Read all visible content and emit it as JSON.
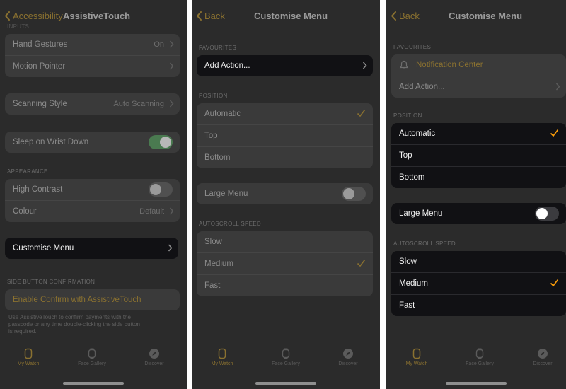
{
  "colors": {
    "accent": "#ff9f0a",
    "dim_accent": "#8a7130",
    "toggle_on": "#4a7a50",
    "highlight_bg": "#111114"
  },
  "panel1": {
    "back_label": "Accessibility",
    "title": "AssistiveTouch",
    "partial_section": "INPUTS",
    "inputs": [
      {
        "label": "Hand Gestures",
        "value": "On"
      },
      {
        "label": "Motion Pointer",
        "value": ""
      }
    ],
    "scanning": {
      "label": "Scanning Style",
      "value": "Auto Scanning"
    },
    "sleep": {
      "label": "Sleep on Wrist Down",
      "on": true
    },
    "appearance_header": "APPEARANCE",
    "high_contrast": {
      "label": "High Contrast",
      "on": false
    },
    "colour": {
      "label": "Colour",
      "value": "Default"
    },
    "customise": {
      "label": "Customise Menu"
    },
    "side_button_header": "SIDE BUTTON CONFIRMATION",
    "enable_confirm": {
      "label": "Enable Confirm with AssistiveTouch"
    },
    "footer_lines": [
      "Use AssistiveTouch to confirm payments with the",
      "passcode or any time double-clicking the side button",
      "is required."
    ]
  },
  "panel2": {
    "back_label": "Back",
    "title": "Customise Menu",
    "favourites_header": "FAVOURITES",
    "add_action": "Add Action...",
    "position_header": "POSITION",
    "position_options": [
      "Automatic",
      "Top",
      "Bottom"
    ],
    "position_selected": "Automatic",
    "large_menu": {
      "label": "Large Menu",
      "on": false
    },
    "autoscroll_header": "AUTOSCROLL SPEED",
    "speed_options": [
      "Slow",
      "Medium",
      "Fast"
    ],
    "speed_selected": "Medium"
  },
  "panel3": {
    "back_label": "Back",
    "title": "Customise Menu",
    "favourites_header": "FAVOURITES",
    "notification_center": "Notification Center",
    "add_action": "Add Action...",
    "position_header": "POSITION",
    "position_options": [
      "Automatic",
      "Top",
      "Bottom"
    ],
    "position_selected": "Automatic",
    "large_menu": {
      "label": "Large Menu",
      "on": false
    },
    "autoscroll_header": "AUTOSCROLL SPEED",
    "speed_options": [
      "Slow",
      "Medium",
      "Fast"
    ],
    "speed_selected": "Medium"
  },
  "tabs": [
    {
      "label": "My Watch",
      "icon": "watch-face-icon",
      "active": true
    },
    {
      "label": "Face Gallery",
      "icon": "face-gallery-icon",
      "active": false
    },
    {
      "label": "Discover",
      "icon": "compass-icon",
      "active": false
    }
  ]
}
